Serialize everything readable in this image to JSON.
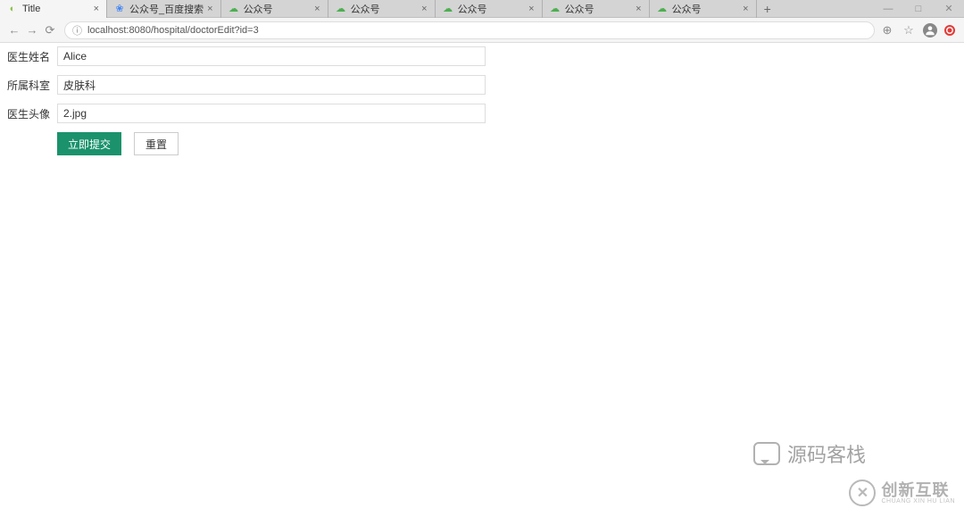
{
  "browser": {
    "tabs": [
      {
        "title": "Title",
        "icon": "leaf"
      },
      {
        "title": "公众号_百度搜索",
        "icon": "baidu"
      },
      {
        "title": "公众号",
        "icon": "green"
      },
      {
        "title": "公众号",
        "icon": "green"
      },
      {
        "title": "公众号",
        "icon": "green"
      },
      {
        "title": "公众号",
        "icon": "green"
      },
      {
        "title": "公众号",
        "icon": "green"
      }
    ],
    "url": "localhost:8080/hospital/doctorEdit?id=3"
  },
  "form": {
    "name_label": "医生姓名",
    "name_value": "Alice",
    "dept_label": "所属科室",
    "dept_value": "皮肤科",
    "avatar_label": "医生头像",
    "avatar_value": "2.jpg",
    "submit_label": "立即提交",
    "reset_label": "重置"
  },
  "watermark": {
    "chat_text": "源码客栈",
    "logo_main": "创新互联",
    "logo_sub": "CHUANG XIN HU LIAN",
    "logo_mark": "✕"
  }
}
